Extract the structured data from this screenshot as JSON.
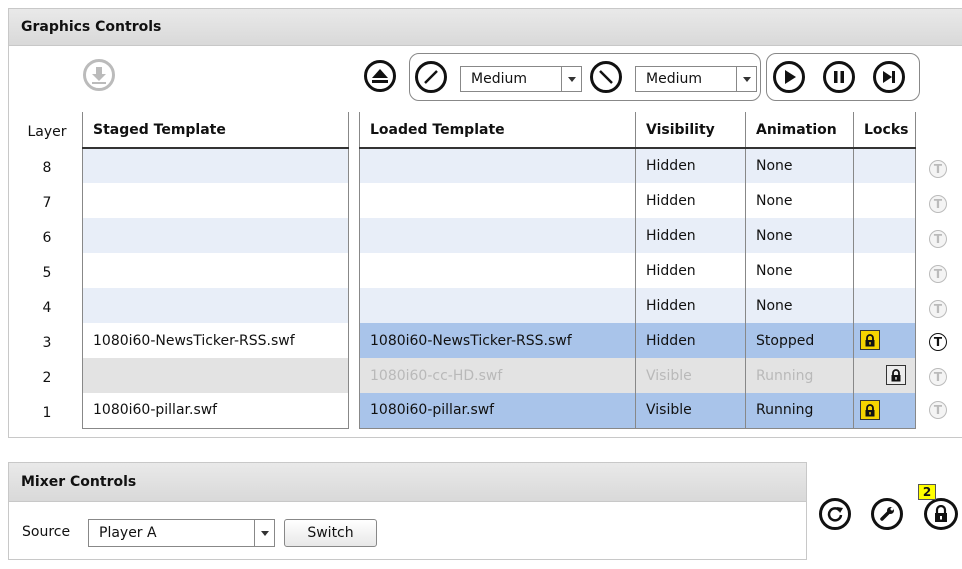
{
  "graphics": {
    "title": "Graphics Controls",
    "layer_header": "Layer",
    "staged_header": "Staged Template",
    "loaded_header": "Loaded Template",
    "visibility_header": "Visibility",
    "animation_header": "Animation",
    "locks_header": "Locks",
    "mix_in_select": "Medium",
    "mix_out_select": "Medium",
    "rows": [
      {
        "layer": "8",
        "staged": "",
        "loaded": "",
        "visibility": "Hidden",
        "animation": "None",
        "lock": ""
      },
      {
        "layer": "7",
        "staged": "",
        "loaded": "",
        "visibility": "Hidden",
        "animation": "None",
        "lock": ""
      },
      {
        "layer": "6",
        "staged": "",
        "loaded": "",
        "visibility": "Hidden",
        "animation": "None",
        "lock": ""
      },
      {
        "layer": "5",
        "staged": "",
        "loaded": "",
        "visibility": "Hidden",
        "animation": "None",
        "lock": ""
      },
      {
        "layer": "4",
        "staged": "",
        "loaded": "",
        "visibility": "Hidden",
        "animation": "None",
        "lock": ""
      },
      {
        "layer": "3",
        "staged": "1080i60-NewsTicker-RSS.swf",
        "loaded": "1080i60-NewsTicker-RSS.swf",
        "visibility": "Hidden",
        "animation": "Stopped",
        "lock": "yellow"
      },
      {
        "layer": "2",
        "staged": "",
        "loaded": "1080i60-cc-HD.swf",
        "visibility": "Visible",
        "animation": "Running",
        "lock": "gray"
      },
      {
        "layer": "1",
        "staged": "1080i60-pillar.swf",
        "loaded": "1080i60-pillar.swf",
        "visibility": "Visible",
        "animation": "Running",
        "lock": "yellow"
      }
    ]
  },
  "mixer": {
    "title": "Mixer Controls",
    "source_label": "Source",
    "source_value": "Player A",
    "switch_label": "Switch"
  },
  "global": {
    "lock_count": "2"
  }
}
